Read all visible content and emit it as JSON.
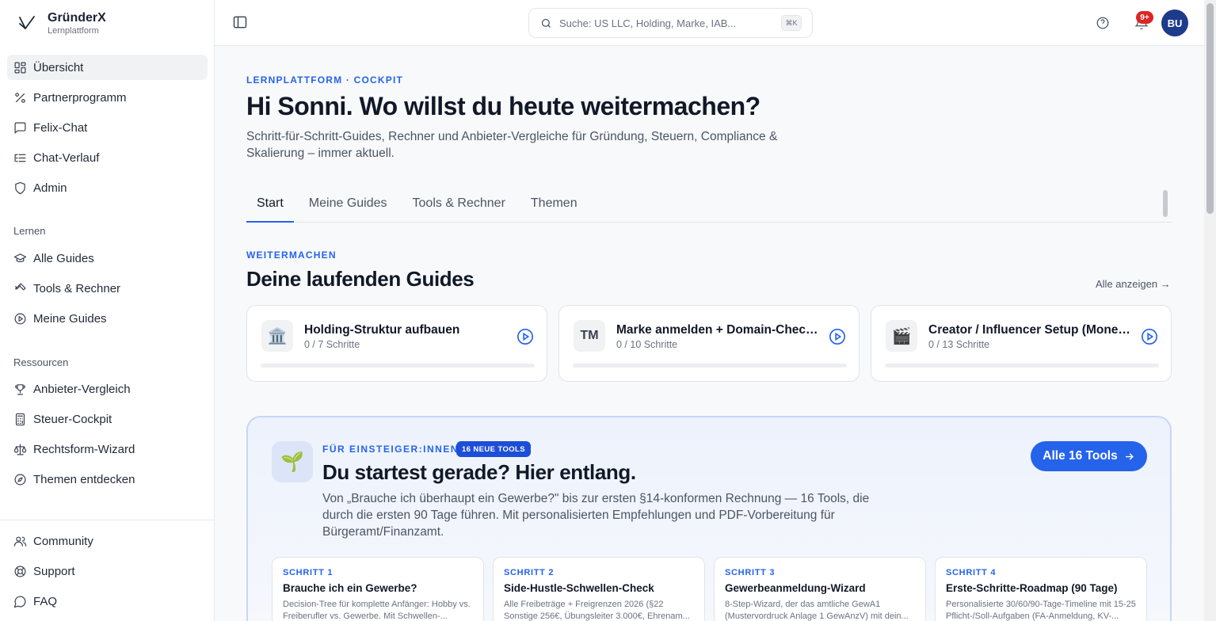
{
  "brand": {
    "name": "GründerX",
    "sub": "Lernplattform"
  },
  "sidebar": {
    "main": [
      {
        "label": "Übersicht",
        "icon": "dashboard-icon"
      },
      {
        "label": "Partnerprogramm",
        "icon": "percent-icon"
      },
      {
        "label": "Felix-Chat",
        "icon": "chat-icon"
      },
      {
        "label": "Chat-Verlauf",
        "icon": "list-icon"
      },
      {
        "label": "Admin",
        "icon": "shield-icon"
      }
    ],
    "lernen_title": "Lernen",
    "lernen": [
      {
        "label": "Alle Guides",
        "icon": "graduation-cap-icon"
      },
      {
        "label": "Tools & Rechner",
        "icon": "wrench-icon"
      },
      {
        "label": "Meine Guides",
        "icon": "play-circle-icon"
      }
    ],
    "ressourcen_title": "Ressourcen",
    "ressourcen": [
      {
        "label": "Anbieter-Vergleich",
        "icon": "trophy-icon"
      },
      {
        "label": "Steuer-Cockpit",
        "icon": "calculator-icon"
      },
      {
        "label": "Rechtsform-Wizard",
        "icon": "scale-icon"
      },
      {
        "label": "Themen entdecken",
        "icon": "compass-icon"
      }
    ],
    "footer": [
      {
        "label": "Community",
        "icon": "users-icon"
      },
      {
        "label": "Support",
        "icon": "lifebuoy-icon"
      },
      {
        "label": "FAQ",
        "icon": "message-icon"
      }
    ]
  },
  "header": {
    "search_placeholder": "Suche: US LLC, Holding, Marke, IAB...",
    "search_kbd": "⌘K",
    "notifications": "9+",
    "avatar": "BU"
  },
  "hero": {
    "eyebrow": "LERNPLATTFORM · COCKPIT",
    "title": "Hi Sonni. Wo willst du heute weitermachen?",
    "lead": "Schritt-für-Schritt-Guides, Rechner und Anbieter-Vergleiche für Gründung, Steuern, Compliance & Skalierung – immer aktuell."
  },
  "tabs": [
    {
      "label": "Start"
    },
    {
      "label": "Meine Guides"
    },
    {
      "label": "Tools & Rechner"
    },
    {
      "label": "Themen"
    }
  ],
  "continue": {
    "eyebrow": "WEITERMACHEN",
    "title": "Deine laufenden Guides",
    "see_all": "Alle anzeigen →",
    "guides": [
      {
        "icon": "🏛️",
        "title": "Holding-Struktur aufbauen",
        "steps": "0 / 7 Schritte",
        "progress": 0
      },
      {
        "icon": "TM",
        "title": "Marke anmelden + Domain-Check (...",
        "steps": "0 / 10 Schritte",
        "progress": 0
      },
      {
        "icon": "🎬",
        "title": "Creator / Influencer Setup (Monetiz...",
        "steps": "0 / 13 Schritte",
        "progress": 0
      }
    ]
  },
  "promo": {
    "icon": "🌱",
    "eyebrow": "FÜR EINSTEIGER:INNEN",
    "badge": "16 NEUE TOOLS",
    "title": "Du startest gerade? Hier entlang.",
    "text": "Von „Brauche ich überhaupt ein Gewerbe?\" bis zur ersten §14-konformen Rechnung — 16 Tools, die durch die ersten 90 Tage führen. Mit personalisierten Empfehlungen und PDF-Vorbereitung für Bürgeramt/Finanzamt.",
    "button": "Alle 16 Tools",
    "steps": [
      {
        "num": "SCHRITT 1",
        "title": "Brauche ich ein Gewerbe?",
        "desc": "Decision-Tree für komplette Anfänger: Hobby vs. Freiberufler vs. Gewerbe. Mit Schwellen-..."
      },
      {
        "num": "SCHRITT 2",
        "title": "Side-Hustle-Schwellen-Check",
        "desc": "Alle Freibeträge + Freigrenzen 2026 (§22 Sonstige 256€, Übungsleiter 3.000€, Ehrenam..."
      },
      {
        "num": "SCHRITT 3",
        "title": "Gewerbeanmeldung-Wizard",
        "desc": "8-Step-Wizard, der das amtliche GewA1 (Mustervordruck Anlage 1 GewAnzV) mit dein..."
      },
      {
        "num": "SCHRITT 4",
        "title": "Erste-Schritte-Roadmap (90 Tage)",
        "desc": "Personalisierte 30/60/90-Tage-Timeline mit 15-25 Pflicht-/Soll-Aufgaben (FA-Anmeldung, KV-..."
      }
    ]
  }
}
